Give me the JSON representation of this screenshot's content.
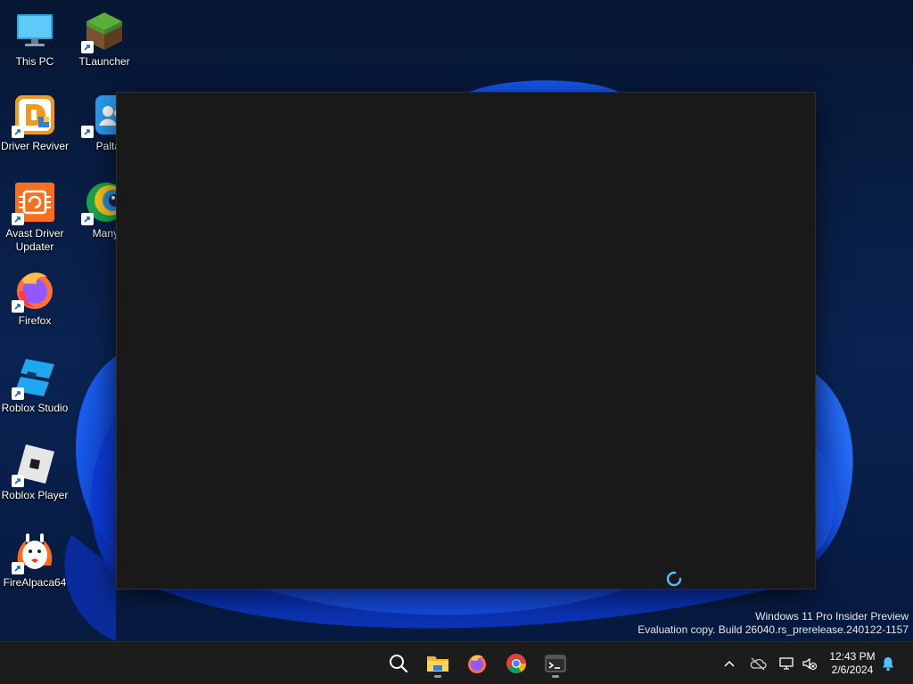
{
  "desktop": {
    "icons": [
      {
        "label": "This PC",
        "icon": "monitor-icon",
        "shortcut": false
      },
      {
        "label": "TLauncher",
        "icon": "grass-block-icon",
        "shortcut": true
      },
      {
        "label": "Driver Reviver",
        "icon": "driver-reviver-icon",
        "shortcut": true
      },
      {
        "label": "Paltall",
        "icon": "paltalk-icon",
        "shortcut": true
      },
      {
        "label": "Avast Driver Updater",
        "icon": "avast-driver-icon",
        "shortcut": true
      },
      {
        "label": "ManyCa",
        "icon": "manycam-icon",
        "shortcut": true
      },
      {
        "label": "Firefox",
        "icon": "firefox-icon",
        "shortcut": true
      },
      {
        "label": "Roblox Studio",
        "icon": "roblox-studio-icon",
        "shortcut": true
      },
      {
        "label": "Roblox Player",
        "icon": "roblox-player-icon",
        "shortcut": true
      },
      {
        "label": "FireAlpaca64",
        "icon": "firealpaca-icon",
        "shortcut": true
      }
    ]
  },
  "window": {
    "state": "loading",
    "background": "#191919",
    "spinner_color": "#4cc2ff"
  },
  "watermark": {
    "line1": "Windows 11 Pro Insider Preview",
    "line2": "Evaluation copy. Build 26040.rs_prerelease.240122-1157"
  },
  "taskbar": {
    "items": [
      {
        "name": "search",
        "icon": "search-icon",
        "running": false
      },
      {
        "name": "file-explorer",
        "icon": "folder-icon",
        "running": true
      },
      {
        "name": "firefox",
        "icon": "firefox-icon",
        "running": false
      },
      {
        "name": "chrome",
        "icon": "chrome-icon",
        "running": false
      },
      {
        "name": "terminal",
        "icon": "terminal-icon",
        "running": true
      }
    ],
    "tray": [
      {
        "name": "show-hidden-icons",
        "icon": "chevron-up-icon"
      },
      {
        "name": "onedrive",
        "icon": "cloud-off-icon"
      },
      {
        "name": "network",
        "icon": "network-icon"
      },
      {
        "name": "volume",
        "icon": "volume-muted-icon"
      }
    ],
    "clock": {
      "time": "12:43 PM",
      "date": "2/6/2024"
    },
    "notifications_icon": "bell-icon"
  },
  "colors": {
    "accent": "#4cc2ff",
    "taskbar": "#1c1c1c",
    "wallpaper_blue": "#1456f0"
  }
}
